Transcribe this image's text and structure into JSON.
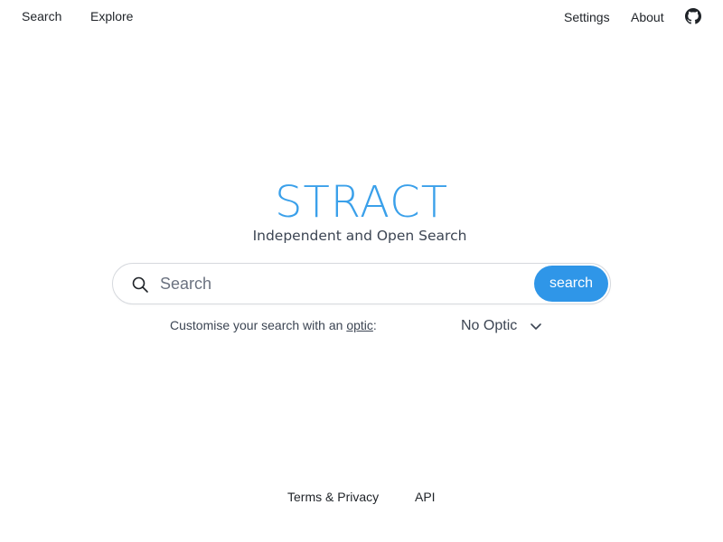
{
  "nav": {
    "left": [
      "Search",
      "Explore"
    ],
    "right": [
      "Settings",
      "About"
    ],
    "github_icon": "github-icon"
  },
  "brand": {
    "logo": "STRACT",
    "tagline": "Independent and Open Search",
    "accent_color": "#3aa0ea"
  },
  "search": {
    "placeholder": "Search",
    "value": "",
    "button_label": "search",
    "icon": "search-icon",
    "button_color": "#2f96e8"
  },
  "optic": {
    "prefix": "Customise your search with an ",
    "link": "optic",
    "suffix": ":",
    "selected": "No Optic",
    "icon": "chevron-down-icon"
  },
  "footer": {
    "links": [
      "Terms & Privacy",
      "API"
    ]
  }
}
